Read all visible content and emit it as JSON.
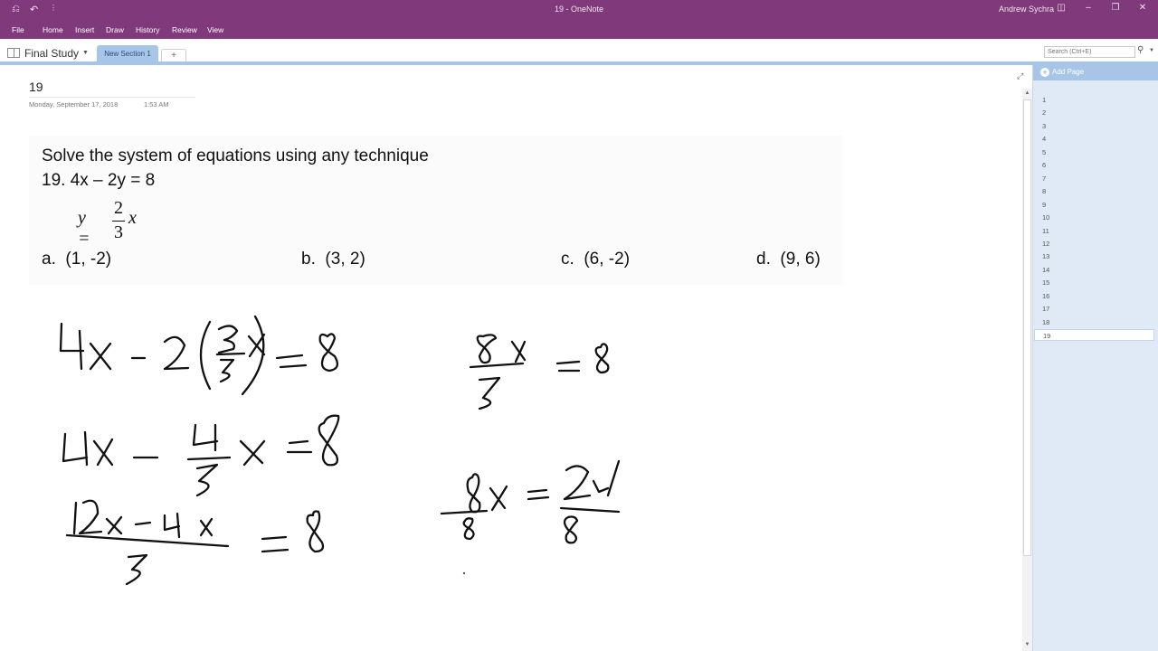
{
  "titlebar": {
    "title": "19  -  OneNote",
    "user": "Andrew Sychra",
    "back_icon": "back-circle-icon",
    "undo_icon": "undo-icon",
    "customize_icon": "more-icon",
    "fullscreen_icon": "fullscreen-icon",
    "minimize_icon": "minimize-icon",
    "restore_icon": "restore-icon",
    "close_icon": "close-icon"
  },
  "menu": {
    "items": [
      "File",
      "Home",
      "Insert",
      "Draw",
      "History",
      "Review",
      "View"
    ]
  },
  "notebook": {
    "name": "Final Study",
    "active_section": "New Section 1",
    "add_section_label": "+"
  },
  "search": {
    "placeholder": "Search (Ctrl+E)"
  },
  "page": {
    "title": "19",
    "date": "Monday, September 17, 2018",
    "time": "1:53 AM"
  },
  "problem": {
    "instruction": "Solve the system of equations using any technique",
    "equation1": "19.  4x – 2y = 8",
    "equation2": {
      "lhs": "y =",
      "numerator": "2",
      "denominator": "3",
      "rhs": "x"
    },
    "choices": [
      {
        "label": "a.",
        "value": "(1, -2)"
      },
      {
        "label": "b.",
        "value": "(3, 2)"
      },
      {
        "label": "c.",
        "value": "(6, -2)"
      },
      {
        "label": "d.",
        "value": "(9, 6)"
      }
    ]
  },
  "handwriting": {
    "lines": [
      "4x - 2(2/3 x) = 8",
      "4x - 4/3 x = 8",
      "(12x - 4x)/3 = 8",
      "8x/3 = 8",
      "8x/8 = 24/8"
    ]
  },
  "pages_pane": {
    "add_page_label": "Add Page",
    "pages": [
      "1",
      "2",
      "3",
      "4",
      "5",
      "6",
      "7",
      "8",
      "9",
      "10",
      "11",
      "12",
      "13",
      "14",
      "15",
      "16",
      "17",
      "18",
      "19"
    ],
    "active_page": "19"
  }
}
